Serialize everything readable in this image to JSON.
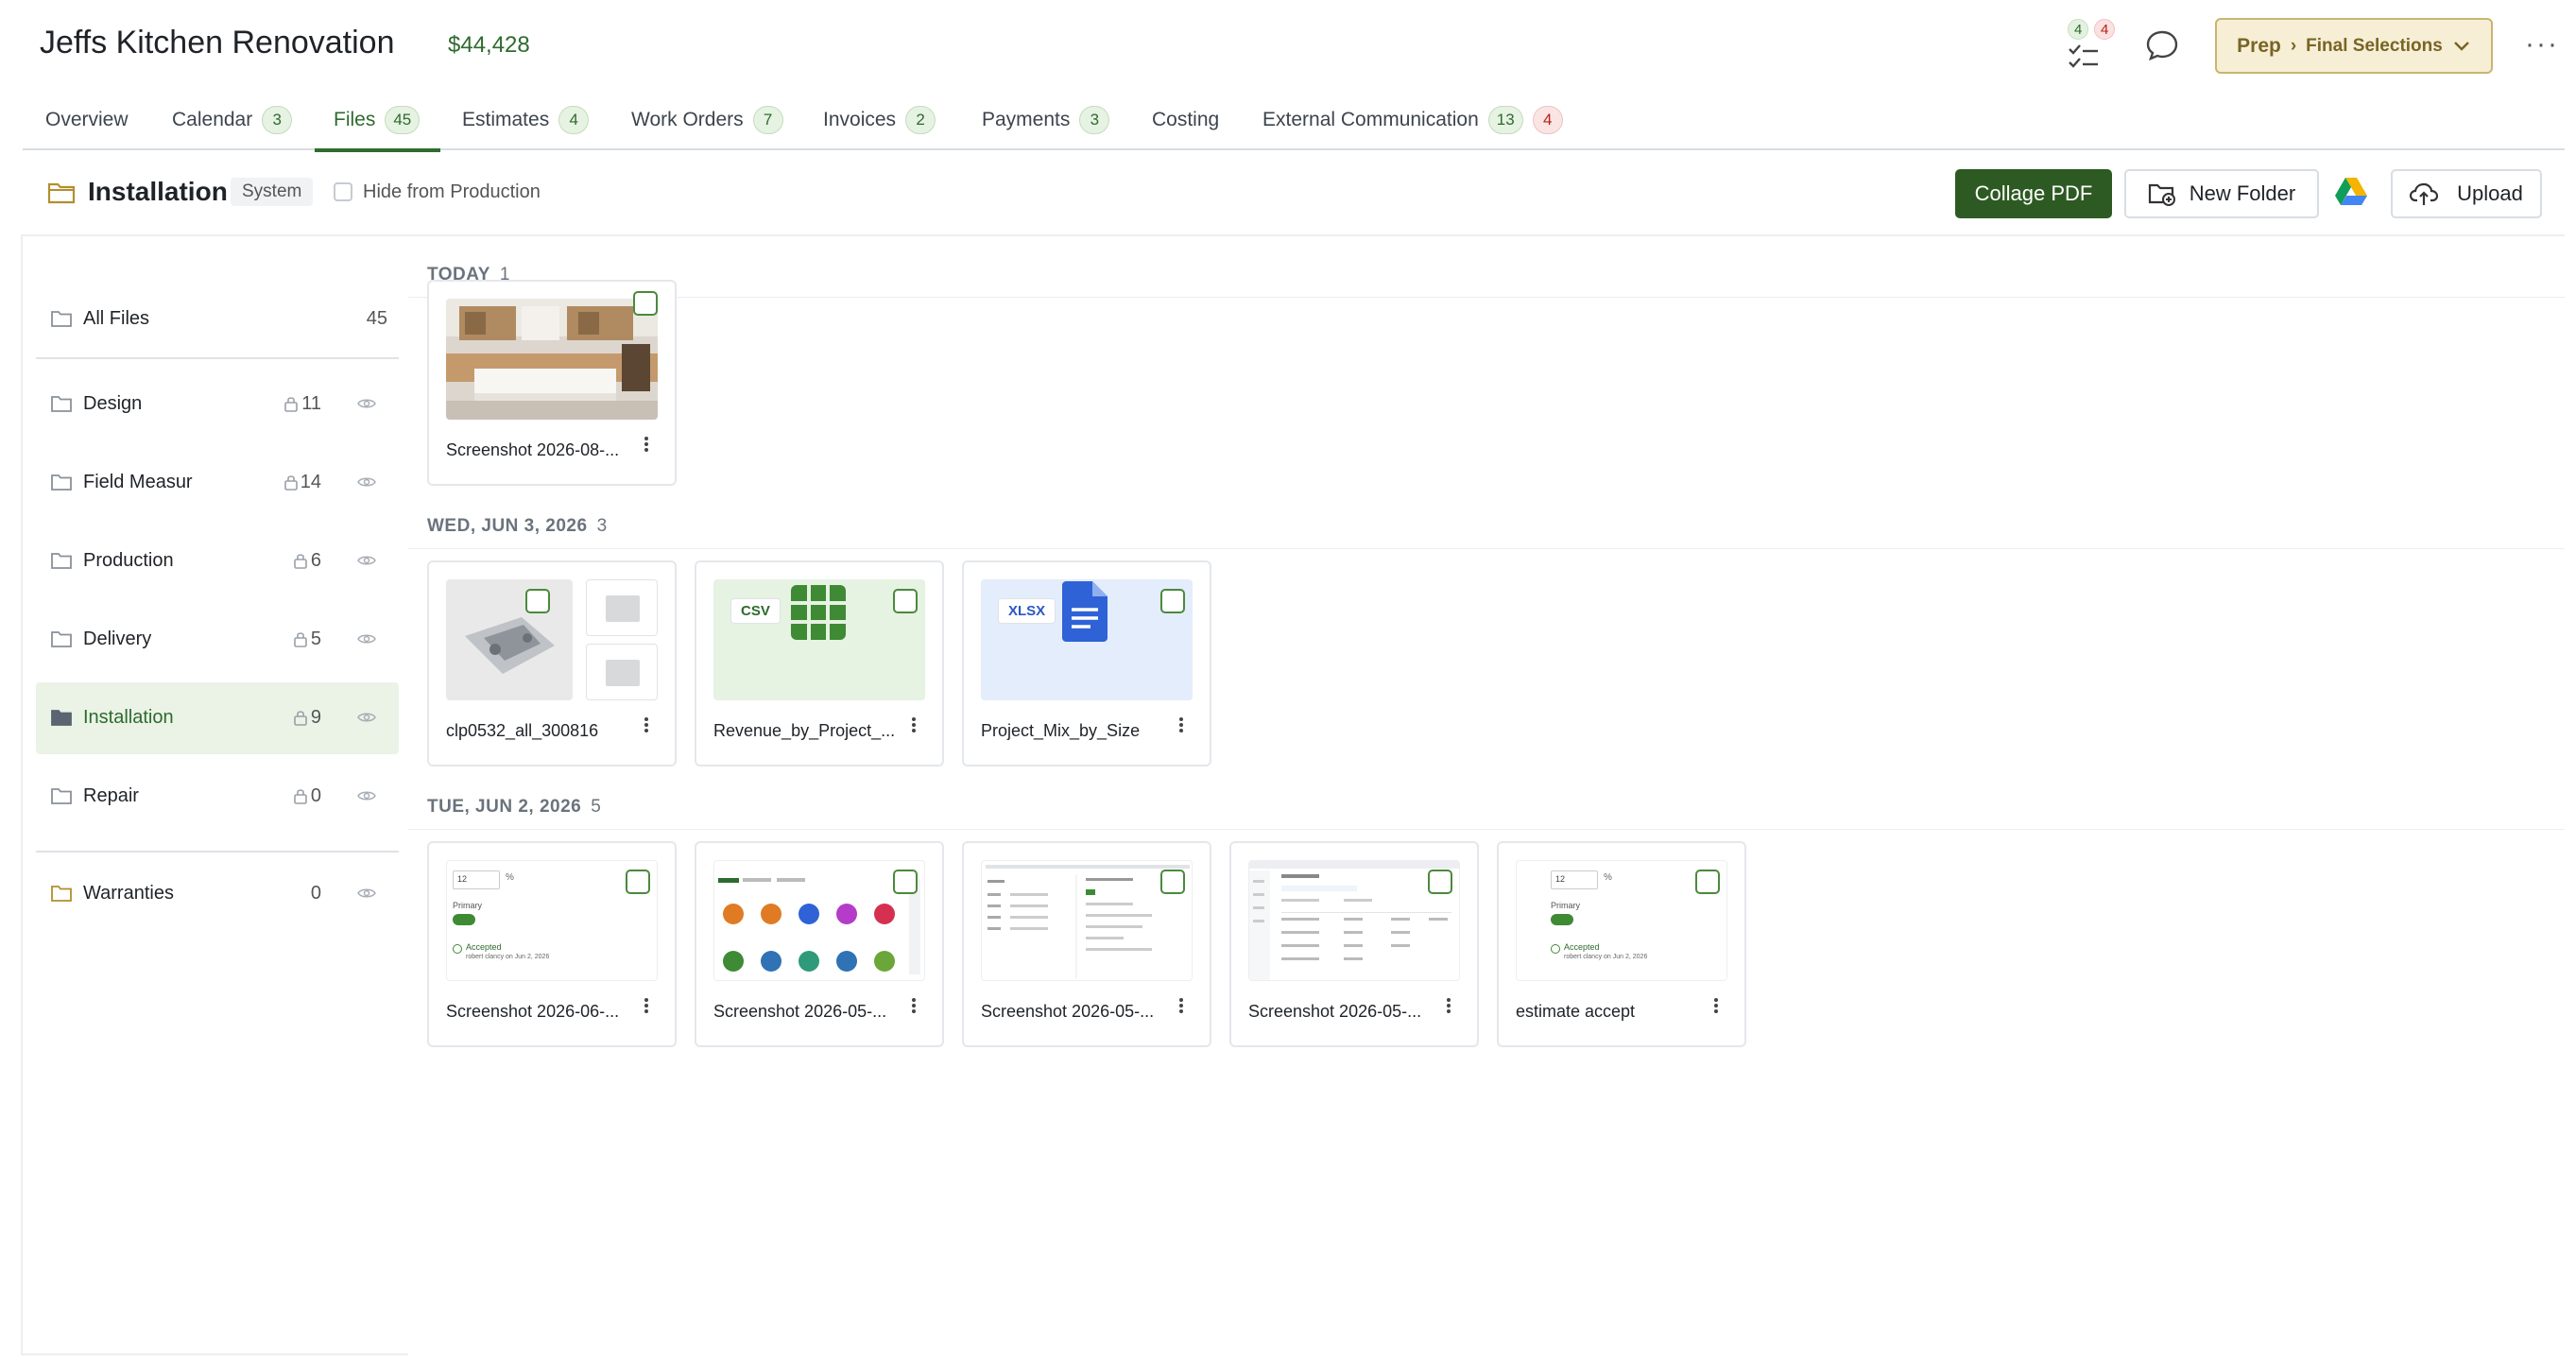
{
  "header": {
    "project_title": "Jeffs Kitchen Renovation",
    "project_total": "$44,428",
    "tasks_green": "4",
    "tasks_red": "4",
    "status_stage": "Prep",
    "status_separator": "›",
    "status_substage": "Final Selections",
    "more_label": "···"
  },
  "tabs": [
    {
      "label": "Overview",
      "count": ""
    },
    {
      "label": "Calendar",
      "count": "3"
    },
    {
      "label": "Files",
      "count": "45"
    },
    {
      "label": "Estimates",
      "count": "4"
    },
    {
      "label": "Work Orders",
      "count": "7"
    },
    {
      "label": "Invoices",
      "count": "2"
    },
    {
      "label": "Payments",
      "count": "3"
    },
    {
      "label": "Costing",
      "count": ""
    },
    {
      "label": "External Communication",
      "count": "13",
      "count_red": "4"
    }
  ],
  "folder_bar": {
    "name": "Installation",
    "chip": "System",
    "hide_label": "Hide from Production",
    "collage_label": "Collage PDF",
    "new_folder_label": "New Folder",
    "upload_label": "Upload"
  },
  "sidebar": {
    "all_files": {
      "label": "All Files",
      "count": "45"
    },
    "folders": [
      {
        "label": "Design",
        "count": "11"
      },
      {
        "label": "Field Measur",
        "count": "14"
      },
      {
        "label": "Production",
        "count": "6"
      },
      {
        "label": "Delivery",
        "count": "5"
      },
      {
        "label": "Installation",
        "count": "9"
      },
      {
        "label": "Repair",
        "count": "0"
      }
    ],
    "warranties": {
      "label": "Warranties",
      "count": "0"
    }
  },
  "groups": [
    {
      "label": "TODAY",
      "count": "1",
      "files": [
        {
          "name": "Screenshot 2026-08-..."
        }
      ]
    },
    {
      "label": "WED, JUN 3, 2026",
      "count": "3",
      "files": [
        {
          "name": "clp0532_all_300816"
        },
        {
          "name": "Revenue_by_Project_...",
          "type": "CSV"
        },
        {
          "name": "Project_Mix_by_Size",
          "type": "XLSX"
        }
      ]
    },
    {
      "label": "TUE, JUN 2, 2026",
      "count": "5",
      "files": [
        {
          "name": "Screenshot 2026-06-..."
        },
        {
          "name": "Screenshot 2026-05-..."
        },
        {
          "name": "Screenshot 2026-05-..."
        },
        {
          "name": "Screenshot 2026-05-..."
        },
        {
          "name": "estimate accept"
        }
      ]
    }
  ],
  "thumb_text": {
    "pct_value": "12",
    "pct_sign": "%",
    "primary_label": "Primary",
    "accepted_label": "Accepted",
    "accepted_by": "robert clancy on Jun 2, 2026"
  },
  "colors": {
    "brand_green": "#2d5a22",
    "status_fill": "#f6efd6",
    "status_border": "#c9b56e"
  },
  "icons": {
    "folder": "folder-icon",
    "lock": "lock-icon",
    "eye": "eye-icon",
    "tasks": "checklist-icon",
    "chat": "chat-icon",
    "drive": "google-drive-icon",
    "upload": "cloud-upload-icon",
    "new_folder": "folder-plus-icon"
  }
}
